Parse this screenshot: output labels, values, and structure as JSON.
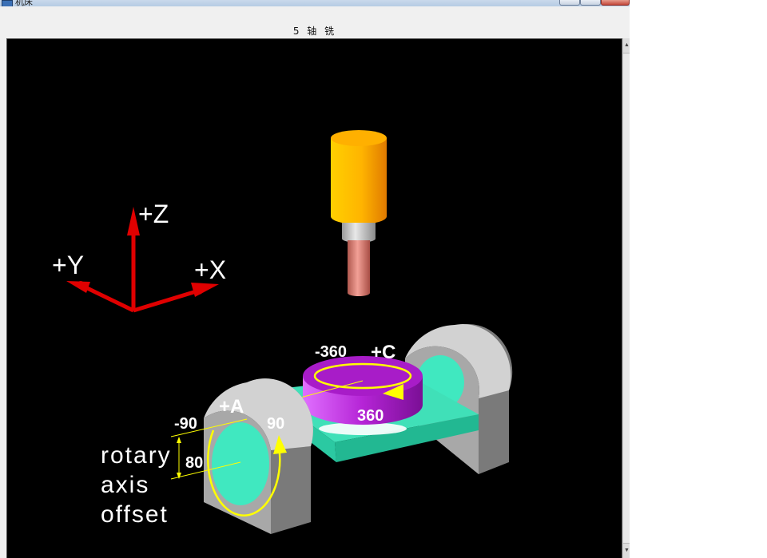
{
  "window": {
    "title": "机床",
    "caption": "5 轴 铣"
  },
  "axes": {
    "z_label": "+Z",
    "y_label": "+Y",
    "x_label": "+X"
  },
  "rotary": {
    "c_label": "+C",
    "c_min": "-360",
    "c_max": "360",
    "a_label": "+A",
    "a_min": "-90",
    "a_max": "90",
    "offset_value": "80",
    "offset_caption_line1": "rotary",
    "offset_caption_line2": "axis",
    "offset_caption_line3": "offset"
  },
  "colors": {
    "axis_arrows": "#e00000",
    "spindle_housing": "#ffb000",
    "tool": "#d97a6e",
    "rotary_table": "#b01ed0",
    "table_base": "#3ee0b8",
    "trunnion": "#b5b5b5",
    "direction_arrows": "#ffff00",
    "viewport_background": "#000000"
  }
}
